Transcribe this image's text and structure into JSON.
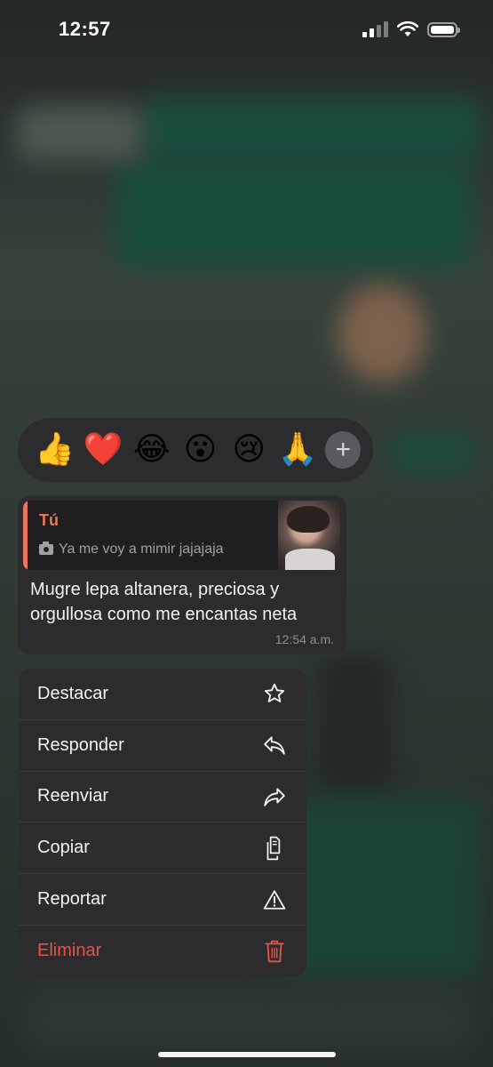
{
  "status_bar": {
    "time": "12:57"
  },
  "reactions": {
    "emojis": [
      "👍",
      "❤️",
      "😂",
      "😮",
      "😢",
      "🙏"
    ],
    "more_label": "+"
  },
  "message": {
    "quoted_author": "Tú",
    "quoted_caption": "Ya me voy a mimir jajajaja",
    "text": "Mugre lepa altanera, preciosa y orgullosa como me encantas neta",
    "time": "12:54 a.m."
  },
  "menu": {
    "items": [
      {
        "label": "Destacar",
        "icon": "star-icon"
      },
      {
        "label": "Responder",
        "icon": "reply-icon"
      },
      {
        "label": "Reenviar",
        "icon": "forward-icon"
      },
      {
        "label": "Copiar",
        "icon": "copy-icon"
      },
      {
        "label": "Reportar",
        "icon": "warning-icon"
      },
      {
        "label": "Eliminar",
        "icon": "trash-icon",
        "color": "#e5534b"
      }
    ]
  },
  "colors": {
    "accent_quote": "#e9765d",
    "danger": "#e5534b",
    "panel": "#2c2c2e"
  }
}
